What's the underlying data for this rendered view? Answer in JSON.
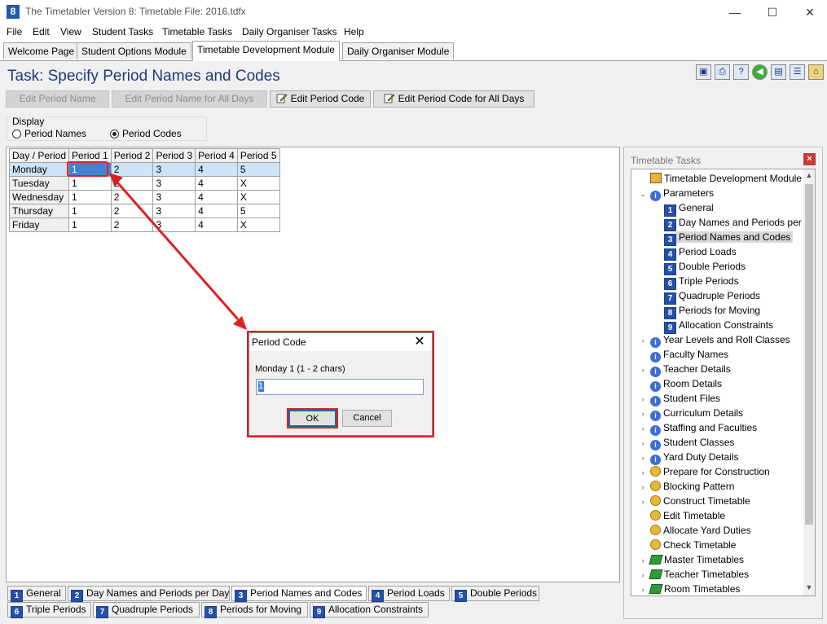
{
  "window": {
    "app_number": "8",
    "title": "The Timetabler Version 8: Timetable File: 2016.tdfx",
    "minimize": "—",
    "maximize": "☐",
    "close": "✕"
  },
  "menu": [
    "File",
    "Edit",
    "View",
    "Student Tasks",
    "Timetable Tasks",
    "Daily Organiser Tasks",
    "Help"
  ],
  "module_tabs": [
    {
      "label": "Welcome Page",
      "active": false
    },
    {
      "label": "Student Options Module",
      "active": false
    },
    {
      "label": "Timetable Development Module",
      "active": true
    },
    {
      "label": "Daily Organiser Module",
      "active": false
    }
  ],
  "task_title": "Task: Specify Period Names and Codes",
  "toolbar_icons": [
    "save-icon",
    "print-icon",
    "help-icon",
    "back-icon",
    "window-icon",
    "tree-icon",
    "home-icon"
  ],
  "buttons": {
    "edit_period_name": "Edit Period Name",
    "edit_period_name_all": "Edit Period Name for All Days",
    "edit_period_code": "Edit Period Code",
    "edit_period_code_all": "Edit Period Code for All Days"
  },
  "display": {
    "label": "Display",
    "option_names": "Period Names",
    "option_codes": "Period Codes",
    "selected": "Period Codes"
  },
  "grid": {
    "corner": "Day / Period",
    "columns": [
      "Period 1",
      "Period 2",
      "Period 3",
      "Period 4",
      "Period 5"
    ],
    "rows": [
      {
        "day": "Monday",
        "cells": [
          "1",
          "2",
          "3",
          "4",
          "5"
        ]
      },
      {
        "day": "Tuesday",
        "cells": [
          "1",
          "2",
          "3",
          "4",
          "X"
        ]
      },
      {
        "day": "Wednesday",
        "cells": [
          "1",
          "2",
          "3",
          "4",
          "X"
        ]
      },
      {
        "day": "Thursday",
        "cells": [
          "1",
          "2",
          "3",
          "4",
          "5"
        ]
      },
      {
        "day": "Friday",
        "cells": [
          "1",
          "2",
          "3",
          "4",
          "X"
        ]
      }
    ]
  },
  "dialog": {
    "title": "Period Code",
    "close": "✕",
    "prompt": "Monday 1 (1 - 2 chars)",
    "value": "1",
    "ok": "OK",
    "cancel": "Cancel"
  },
  "tasks_panel": {
    "header": "Timetable Tasks",
    "close": "×",
    "items": [
      {
        "label": "Timetable Development Module",
        "icon": "house",
        "level": 0
      },
      {
        "label": "Parameters",
        "icon": "info",
        "level": 0,
        "expanded": true
      },
      {
        "label": "General",
        "icon": "num",
        "num": "1",
        "level": 1
      },
      {
        "label": "Day Names and Periods per D",
        "icon": "num",
        "num": "2",
        "level": 1
      },
      {
        "label": "Period Names and Codes",
        "icon": "num",
        "num": "3",
        "level": 1,
        "selected": true
      },
      {
        "label": "Period Loads",
        "icon": "num",
        "num": "4",
        "level": 1
      },
      {
        "label": "Double Periods",
        "icon": "num",
        "num": "5",
        "level": 1
      },
      {
        "label": "Triple Periods",
        "icon": "num",
        "num": "6",
        "level": 1
      },
      {
        "label": "Quadruple Periods",
        "icon": "num",
        "num": "7",
        "level": 1
      },
      {
        "label": "Periods for Moving",
        "icon": "num",
        "num": "8",
        "level": 1
      },
      {
        "label": "Allocation Constraints",
        "icon": "num",
        "num": "9",
        "level": 1
      },
      {
        "label": "Year Levels and Roll Classes",
        "icon": "info",
        "level": 0,
        "expandable": true
      },
      {
        "label": "Faculty Names",
        "icon": "info",
        "level": 0
      },
      {
        "label": "Teacher Details",
        "icon": "info",
        "level": 0,
        "expandable": true
      },
      {
        "label": "Room Details",
        "icon": "info",
        "level": 0
      },
      {
        "label": "Student Files",
        "icon": "info",
        "level": 0,
        "expandable": true
      },
      {
        "label": "Curriculum Details",
        "icon": "info",
        "level": 0,
        "expandable": true
      },
      {
        "label": "Staffing and Faculties",
        "icon": "info",
        "level": 0,
        "expandable": true
      },
      {
        "label": "Student Classes",
        "icon": "info",
        "level": 0,
        "expandable": true
      },
      {
        "label": "Yard Duty Details",
        "icon": "info",
        "level": 0,
        "expandable": true
      },
      {
        "label": "Prepare for Construction",
        "icon": "gear",
        "level": 0,
        "expandable": true
      },
      {
        "label": "Blocking Pattern",
        "icon": "gear",
        "level": 0,
        "expandable": true
      },
      {
        "label": "Construct Timetable",
        "icon": "gear",
        "level": 0,
        "expandable": true
      },
      {
        "label": "Edit Timetable",
        "icon": "gear",
        "level": 0
      },
      {
        "label": "Allocate Yard Duties",
        "icon": "gear",
        "level": 0
      },
      {
        "label": "Check Timetable",
        "icon": "gear",
        "level": 0
      },
      {
        "label": "Master Timetables",
        "icon": "green",
        "level": 0,
        "expandable": true
      },
      {
        "label": "Teacher Timetables",
        "icon": "green",
        "level": 0,
        "expandable": true
      },
      {
        "label": "Room Timetables",
        "icon": "green",
        "level": 0,
        "expandable": true
      }
    ]
  },
  "bottom_tabs": [
    {
      "num": "1",
      "label": "General"
    },
    {
      "num": "2",
      "label": "Day Names and Periods per Day"
    },
    {
      "num": "3",
      "label": "Period Names and Codes",
      "active": true
    },
    {
      "num": "4",
      "label": "Period Loads"
    },
    {
      "num": "5",
      "label": "Double Periods"
    },
    {
      "num": "6",
      "label": "Triple Periods"
    },
    {
      "num": "7",
      "label": "Quadruple Periods"
    },
    {
      "num": "8",
      "label": "Periods for Moving"
    },
    {
      "num": "9",
      "label": "Allocation Constraints"
    }
  ],
  "colors": {
    "accent": "#1f3a7a",
    "annotation": "#e02020",
    "selection": "#3d84d6"
  }
}
